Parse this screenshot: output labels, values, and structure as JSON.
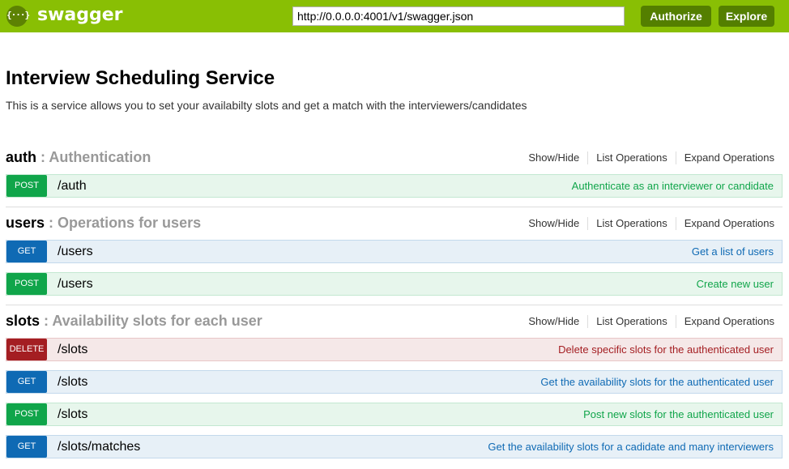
{
  "header": {
    "brand": "swagger",
    "logo_glyph": "{···}",
    "url_value": "http://0.0.0.0:4001/v1/swagger.json",
    "authorize_label": "Authorize",
    "explore_label": "Explore",
    "bar_color": "#89bf04"
  },
  "info": {
    "title": "Interview Scheduling Service",
    "description": "This is a service allows you to set your availabilty slots and get a match with the interviewers/candidates"
  },
  "resource_controls": [
    "Show/Hide",
    "List Operations",
    "Expand Operations"
  ],
  "resources": [
    {
      "name": "auth",
      "separator": " : ",
      "description": "Authentication",
      "operations": [
        {
          "method": "POST",
          "path": "/auth",
          "summary": "Authenticate as an interviewer or candidate"
        }
      ]
    },
    {
      "name": "users",
      "separator": " : ",
      "description": "Operations for users",
      "operations": [
        {
          "method": "GET",
          "path": "/users",
          "summary": "Get a list of users"
        },
        {
          "method": "POST",
          "path": "/users",
          "summary": "Create new user"
        }
      ]
    },
    {
      "name": "slots",
      "separator": " : ",
      "description": "Availability slots for each user",
      "operations": [
        {
          "method": "DELETE",
          "path": "/slots",
          "summary": "Delete specific slots for the authenticated user"
        },
        {
          "method": "GET",
          "path": "/slots",
          "summary": "Get the availability slots for the authenticated user"
        },
        {
          "method": "POST",
          "path": "/slots",
          "summary": "Post new slots for the authenticated user"
        },
        {
          "method": "GET",
          "path": "/slots/matches",
          "summary": "Get the availability slots for a cadidate and many interviewers"
        }
      ]
    }
  ],
  "method_colors": {
    "GET": "#0f6ab4",
    "POST": "#10a54a",
    "DELETE": "#a41e22"
  }
}
